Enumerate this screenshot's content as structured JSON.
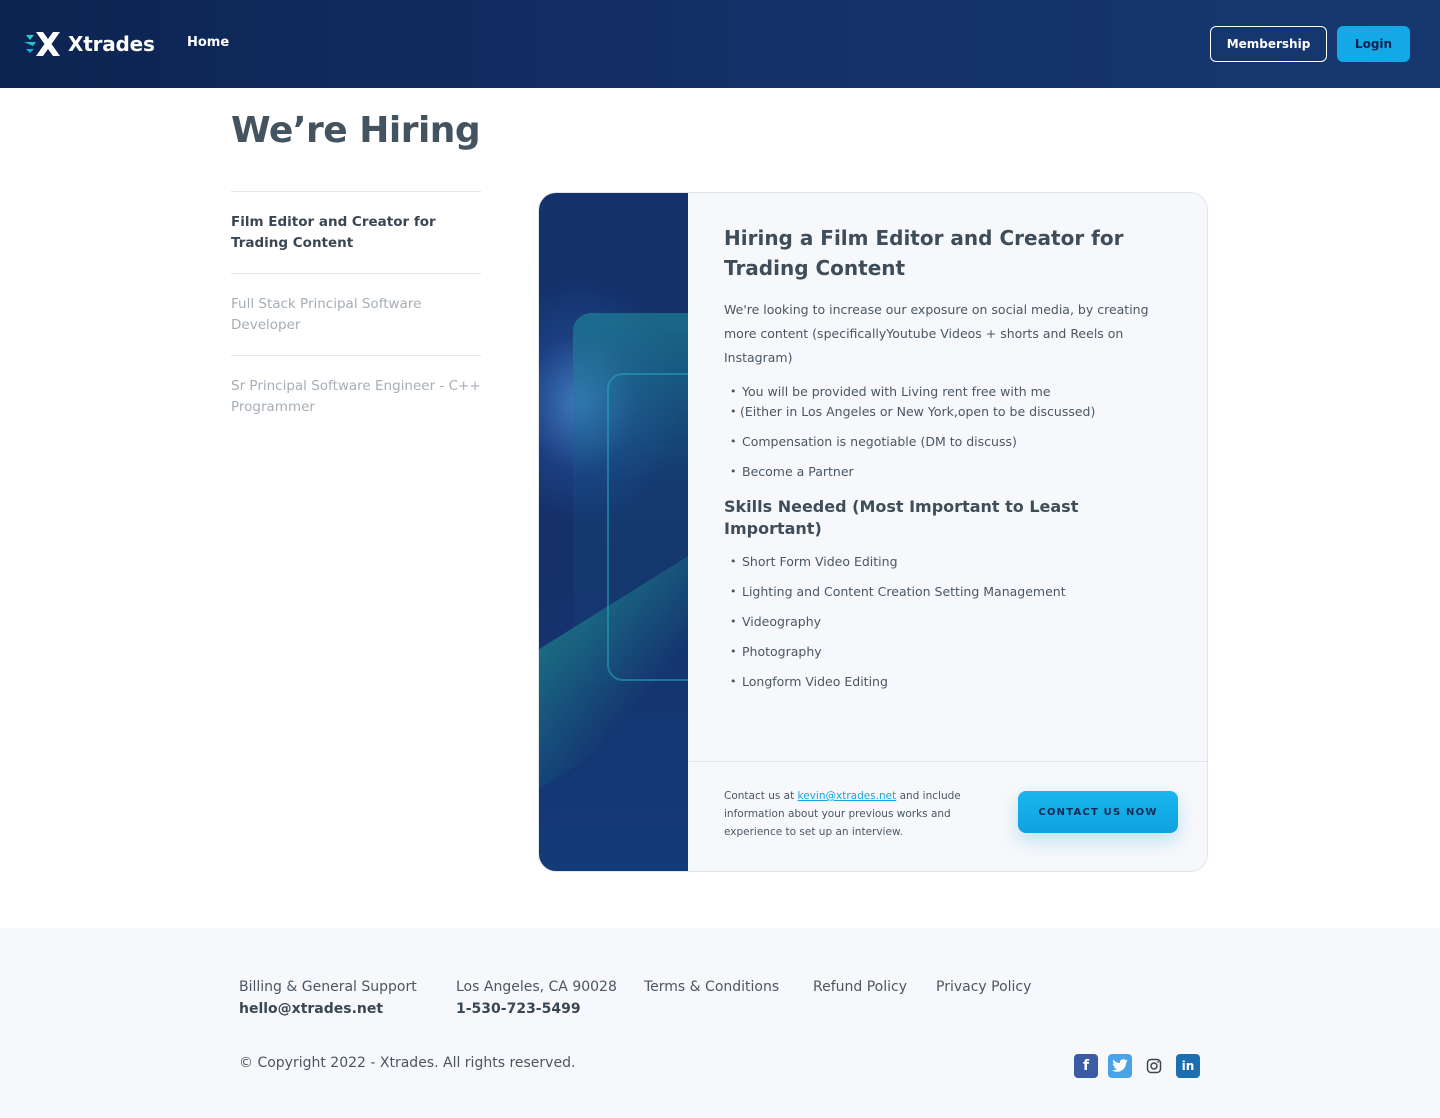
{
  "header": {
    "brand": "Xtrades",
    "nav_home": "Home",
    "membership_label": "Membership",
    "login_label": "Login"
  },
  "page": {
    "title": "We’re Hiring"
  },
  "jobs": [
    {
      "label": "Film Editor and Creator for Trading Content",
      "active": true
    },
    {
      "label": "Full Stack Principal Software Developer",
      "active": false
    },
    {
      "label": "Sr Principal Software Engineer - C++ Programmer",
      "active": false
    }
  ],
  "card": {
    "title": "Hiring a Film Editor and Creator for Trading Content",
    "intro": "We're looking to increase our exposure on social media, by creating more content (specificallyYoutube Videos + shorts and Reels on Instagram)",
    "benefits": [
      "You will be provided with Living rent free with me",
      "(Either in Los Angeles or New York,open to be discussed)",
      "Compensation is negotiable (DM to discuss)",
      "Become a Partner"
    ],
    "skills_title": "Skills Needed (Most Important to Least Important)",
    "skills": [
      "Short Form Video Editing",
      "Lighting and Content Creation Setting Management",
      "Videography",
      "Photography",
      "Longform Video Editing"
    ],
    "contact_prefix": "Contact us at ",
    "contact_email": "kevin@xtrades.net",
    "contact_suffix": " and include information about your previous works and experience to set up an interview.",
    "contact_button": "CONTACT US NOW"
  },
  "footer": {
    "support_label": "Billing & General Support",
    "support_email": "hello@xtrades.net",
    "address": "Los Angeles, CA 90028",
    "phone": "1-530-723-5499",
    "terms": "Terms & Conditions",
    "refund": "Refund Policy",
    "privacy": "Privacy Policy",
    "copyright": "© Copyright 2022 - Xtrades. All rights reserved.",
    "social": [
      "facebook-icon",
      "twitter-icon",
      "instagram-icon",
      "linkedin-icon"
    ]
  },
  "colors": {
    "header_bg": "#0c2451",
    "accent": "#14a8e6",
    "text": "#3d4a57",
    "footer_bg": "#f7f8fb"
  }
}
